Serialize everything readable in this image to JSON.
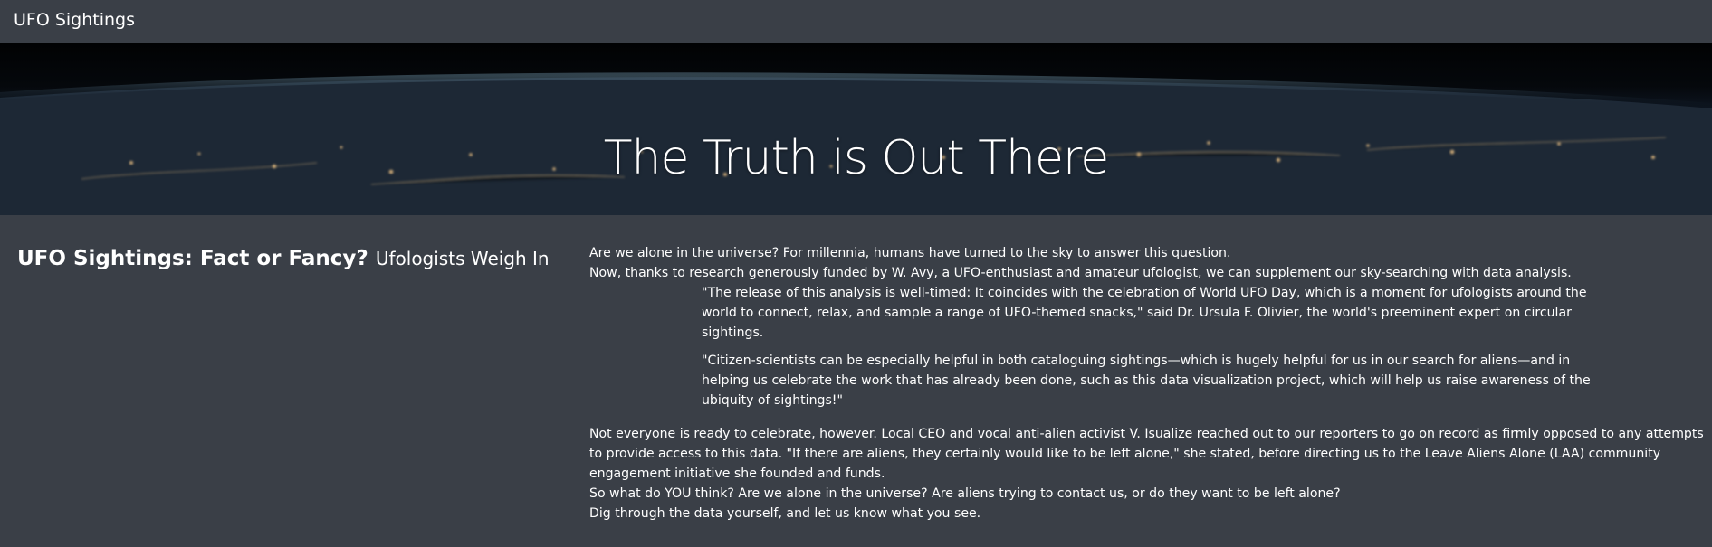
{
  "nav": {
    "brand": "UFO Sightings"
  },
  "hero": {
    "title": "The Truth is Out There"
  },
  "sidebar": {
    "heading_main": "UFO Sightings: Fact or Fancy?",
    "heading_sub": "Ufologists Weigh In"
  },
  "article": {
    "intro_1": "Are we alone in the universe? For millennia, humans have turned to the sky to answer this question.",
    "intro_2": "Now, thanks to research generously funded by W. Avy, a UFO-enthusiast and amateur ufologist, we can supplement our sky-searching with data analysis.",
    "quote_1": "\"The release of this analysis is well-timed: It coincides with the celebration of World UFO Day, which is a moment for ufologists around the world to connect, relax, and sample a range of UFO-themed snacks,\" said Dr. Ursula F. Olivier, the world's preeminent expert on circular sightings.",
    "quote_2": "\"Citizen-scientists can be especially helpful in both cataloguing sightings—which is hugely helpful for us in our search for aliens—and in helping us celebrate the work that has already been done, such as this data visualization project, which will help us raise awareness of the ubiquity of sightings!\"",
    "paragraph_3": "Not everyone is ready to celebrate, however. Local CEO and vocal anti-alien activist V. Isualize reached out to our reporters to go on record as firmly opposed to any attempts to provide access to this data. \"If there are aliens, they certainly would like to be left alone,\" she stated, before directing us to the Leave Aliens Alone (LAA) community engagement initiative she founded and funds.",
    "closing_1": "So what do YOU think? Are we alone in the universe? Are aliens trying to contact us, or do they want to be left alone?",
    "closing_2": "Dig through the data yourself, and let us know what you see."
  },
  "colors": {
    "background": "#3a3f47",
    "text": "#ffffff",
    "city_lights": "#ffd28c"
  }
}
